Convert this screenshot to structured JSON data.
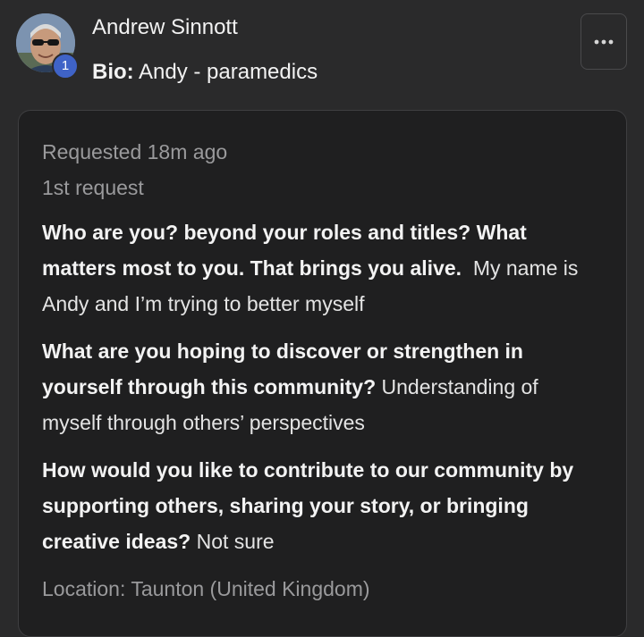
{
  "header": {
    "user_name": "Andrew Sinnott",
    "badge_count": "1",
    "bio_label": "Bio:",
    "bio_value": "Andy - paramedics",
    "more_icon": "more-horizontal-icon"
  },
  "request": {
    "requested_time": "Requested 18m ago",
    "request_count": "1st request",
    "items": [
      {
        "question": "Who are you? beyond your roles and titles? What matters most to you. That brings you alive.",
        "answer": "My name is Andy and I’m trying to better myself"
      },
      {
        "question": "What are you hoping to discover or strengthen in yourself through this community?",
        "answer": "Understanding of myself through others’ perspectives"
      },
      {
        "question": "How would you like to contribute to our community by supporting others, sharing your story, or bringing creative ideas?",
        "answer": "Not sure"
      }
    ],
    "location": "Location: Taunton (United Kingdom)"
  },
  "colors": {
    "background": "#2a2a2b",
    "card_background": "#1f1f20",
    "muted_text": "#9a9a9c",
    "badge": "#3f63c7"
  }
}
